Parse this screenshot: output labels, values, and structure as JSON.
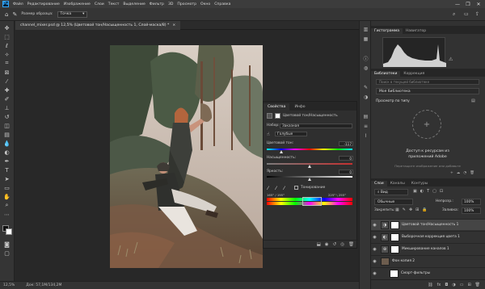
{
  "menubar": {
    "logo": "Ps",
    "items": [
      "Файл",
      "Редактирование",
      "Изображение",
      "Слои",
      "Текст",
      "Выделение",
      "Фильтр",
      "3D",
      "Просмотр",
      "Окно",
      "Справка"
    ],
    "min": "—",
    "max": "❐",
    "close": "✕"
  },
  "options": {
    "brush_size_label": "Размер образца:",
    "brush_size_value": "Точка"
  },
  "document": {
    "tab_title": "channel_mixer.psd @ 12,5% (Цветовой тон/Насыщенность 1, Слой-маска/8) *",
    "close": "×"
  },
  "status": {
    "zoom": "12,5%",
    "doc": "Док: 57,1М/134,2М"
  },
  "properties": {
    "tabs": [
      "Свойства",
      "Инфо"
    ],
    "layer_type": "Цветовой тон/Насыщенность",
    "preset_label": "Набор:",
    "preset_value": "Заказная",
    "channel_value": "Голубые",
    "hue_label": "Цветовой тон:",
    "hue_value": "-117",
    "saturation_label": "Насыщенность:",
    "saturation_value": "0",
    "lightness_label": "Яркость:",
    "lightness_value": "0",
    "tint_label": "Тонирование",
    "range_left": "165° / 195°",
    "range_right": "225° \\ 255°",
    "hue_fraction": 0.17,
    "saturation_fraction": 0.5,
    "lightness_fraction": 0.5
  },
  "panels": {
    "top_tabs": [
      "Гистограмма",
      "Навигатор"
    ],
    "lib_tabs": [
      "Библиотеки",
      "Коррекция"
    ],
    "lib_search_placeholder": "Поиск в текущей библиотеке",
    "my_library": "Моя библиотека",
    "view_by_type": "Просмотр по типу",
    "access_text_1": "Доступ к ресурсам из",
    "access_text_2": "приложений Adobe",
    "drag_hint": "Перетащите изображение или добавьте",
    "layer_tabs": [
      "Слои",
      "Каналы",
      "Контуры"
    ],
    "kind_label": "Вид",
    "blend_mode": "Обычные",
    "opacity_label": "Непрозр.:",
    "opacity_value": "100%",
    "lock_label": "Закрепить:",
    "fill_label": "Заливка:",
    "fill_value": "100%",
    "layers": [
      {
        "name": "Цветовой тон/Насыщенность 1",
        "icon": "hue-sat-icon"
      },
      {
        "name": "Выборочная коррекция цвета 1",
        "icon": "selective-color-icon"
      },
      {
        "name": "Микширование каналов 1",
        "icon": "channel-mixer-icon"
      },
      {
        "name": "Фон копия 2",
        "icon": "photo-icon"
      },
      {
        "name": "Смарт-фильтры",
        "icon": "smart-filter-icon"
      }
    ]
  },
  "colors": {
    "accent": "#31a8ff",
    "panel": "#323232",
    "bg": "#282828"
  }
}
